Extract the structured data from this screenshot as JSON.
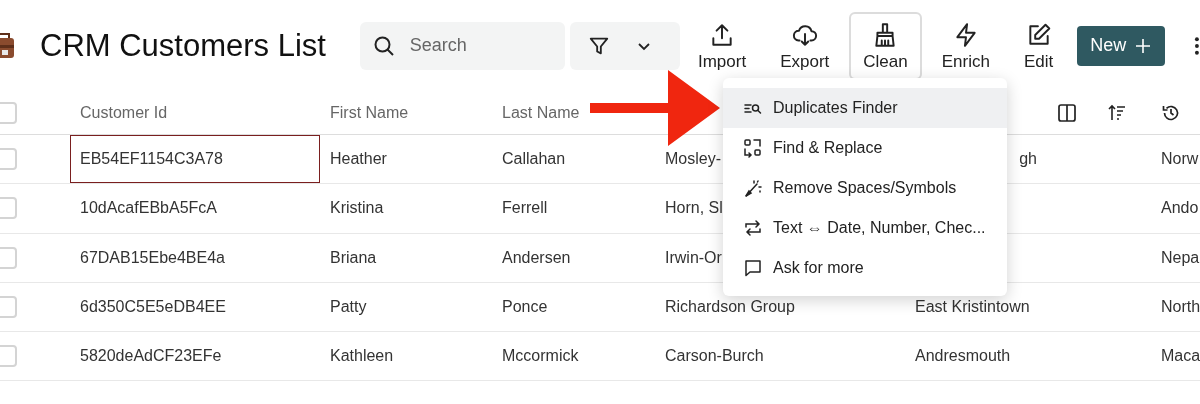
{
  "header": {
    "title": "CRM Customers List",
    "search": {
      "placeholder": "Search"
    },
    "toolbar": [
      {
        "label": "Import",
        "kind": "upload",
        "selected": false
      },
      {
        "label": "Export",
        "kind": "download",
        "selected": false
      },
      {
        "label": "Clean",
        "kind": "broom",
        "selected": true
      },
      {
        "label": "Enrich",
        "kind": "bolt",
        "selected": false
      },
      {
        "label": "Edit",
        "kind": "edit",
        "selected": false
      }
    ],
    "new_button": {
      "label": "New"
    }
  },
  "table": {
    "select_all": {
      "checked": false
    },
    "columns": [
      {
        "label": "Customer Id"
      },
      {
        "label": "First Name"
      },
      {
        "label": "Last Name"
      }
    ],
    "rows": [
      {
        "checked": false,
        "cells": [
          {
            "text": "EB54EF1154C3A78",
            "selected": true
          },
          {
            "text": "Heather",
            "selected": false
          },
          {
            "text": "Callahan",
            "selected": false
          },
          {
            "text": "Mosley-",
            "selected": false
          },
          {
            "text": "gh",
            "selected": false,
            "cut_left": true
          },
          {
            "text": "Norw",
            "selected": false
          }
        ]
      },
      {
        "checked": false,
        "cells": [
          {
            "text": "10dAcafEBbA5FcA",
            "selected": false
          },
          {
            "text": "Kristina",
            "selected": false
          },
          {
            "text": "Ferrell",
            "selected": false
          },
          {
            "text": "Horn, Sl",
            "selected": false
          },
          {
            "selected": false
          },
          {
            "text": "Ando",
            "selected": false
          }
        ]
      },
      {
        "checked": false,
        "cells": [
          {
            "text": "67DAB15Ebe4BE4a",
            "selected": false
          },
          {
            "text": "Briana",
            "selected": false
          },
          {
            "text": "Andersen",
            "selected": false
          },
          {
            "text": "Irwin-Or",
            "selected": false
          },
          {
            "selected": false
          },
          {
            "text": "Nepa",
            "selected": false
          }
        ]
      },
      {
        "checked": false,
        "cells": [
          {
            "text": "6d350C5E5eDB4EE",
            "selected": false
          },
          {
            "text": "Patty",
            "selected": false
          },
          {
            "text": "Ponce",
            "selected": false
          },
          {
            "text": "Richardson Group",
            "selected": false
          },
          {
            "text": "East Kristintown",
            "selected": false
          },
          {
            "text": "North",
            "selected": false
          }
        ]
      },
      {
        "checked": false,
        "cells": [
          {
            "text": "5820deAdCF23EFe",
            "selected": false
          },
          {
            "text": "Kathleen",
            "selected": false
          },
          {
            "text": "Mccormick",
            "selected": false
          },
          {
            "text": "Carson-Burch",
            "selected": false
          },
          {
            "text": "Andresmouth",
            "selected": false
          },
          {
            "text": "Maca",
            "selected": false
          }
        ]
      }
    ]
  },
  "clean_menu": {
    "items": [
      {
        "label": "Duplicates Finder",
        "kind": "duplicates",
        "selected": true
      },
      {
        "label": "Find & Replace",
        "kind": "replace",
        "selected": false
      },
      {
        "label": "Remove Spaces/Symbols",
        "kind": "wand",
        "selected": false
      },
      {
        "label": "Text ⇔ Date, Number, Chec...",
        "kind": "convert",
        "selected": false
      },
      {
        "label": "Ask for more",
        "kind": "chat",
        "selected": false
      }
    ]
  }
}
